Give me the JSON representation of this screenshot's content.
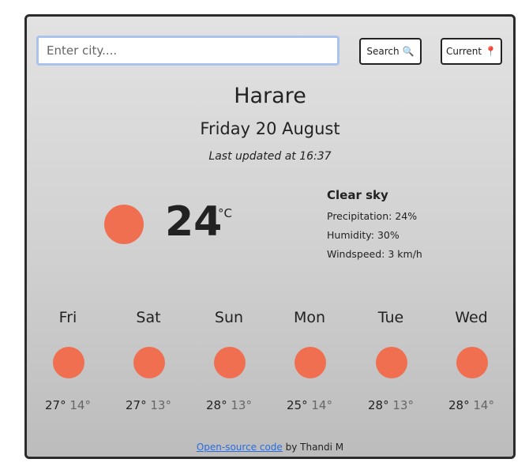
{
  "search": {
    "placeholder": "Enter city....",
    "button_label": "Search",
    "button_icon": "🔍"
  },
  "current_button": {
    "label": "Current",
    "icon": "📍"
  },
  "location": {
    "city": "Harare",
    "date": "Friday 20 August",
    "last_updated": "Last updated at 16:37"
  },
  "current": {
    "temperature": "24",
    "unit": "°C",
    "description": "Clear sky",
    "precipitation": "Precipitation: 24%",
    "humidity": "Humidity: 30%",
    "windspeed": "Windspeed: 3 km/h",
    "icon_color": "#ef6f50"
  },
  "forecast": [
    {
      "day": "Fri",
      "high": "27°",
      "low": "14°"
    },
    {
      "day": "Sat",
      "high": "27°",
      "low": "13°"
    },
    {
      "day": "Sun",
      "high": "28°",
      "low": "13°"
    },
    {
      "day": "Mon",
      "high": "25°",
      "low": "14°"
    },
    {
      "day": "Tue",
      "high": "28°",
      "low": "13°"
    },
    {
      "day": "Wed",
      "high": "28°",
      "low": "14°"
    }
  ],
  "footer": {
    "link_text": "Open-source code",
    "suffix": " by Thandi M"
  }
}
